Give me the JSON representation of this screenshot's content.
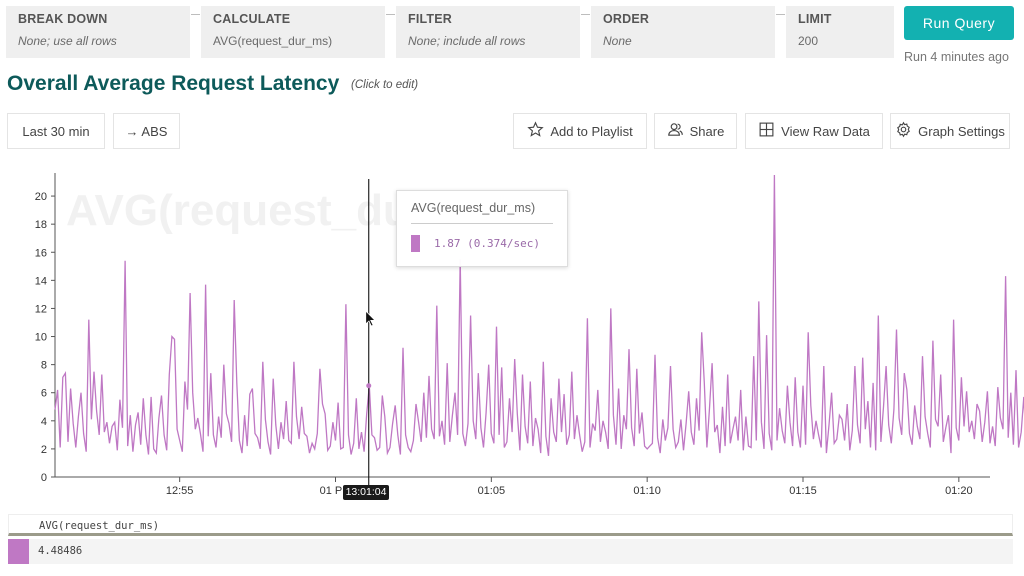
{
  "query": {
    "clauses": [
      {
        "label": "BREAK DOWN",
        "value": "None; use all rows",
        "italic": true
      },
      {
        "label": "CALCULATE",
        "value": "AVG(request_dur_ms)",
        "italic": false
      },
      {
        "label": "FILTER",
        "value": "None; include all rows",
        "italic": true
      },
      {
        "label": "ORDER",
        "value": "None",
        "italic": true
      },
      {
        "label": "LIMIT",
        "value": "200",
        "italic": false
      }
    ],
    "run_label": "Run Query",
    "run_status": "Run 4 minutes ago"
  },
  "header": {
    "title": "Overall Average Request Latency",
    "hint": "(Click to edit)"
  },
  "toolbar": {
    "time_range": "Last 30 min",
    "abs": "→ ABS",
    "add_playlist": "Add to Playlist",
    "share": "Share",
    "raw_data": "View Raw Data",
    "graph_settings": "Graph Settings"
  },
  "tooltip": {
    "title": "AVG(request_dur_ms)",
    "value": "1.87 (0.374/sec)"
  },
  "hover_time": "13:01:04",
  "legend": {
    "header": "AVG(request_dur_ms)",
    "value": "4.48486"
  },
  "colors": {
    "accent": "#13b1b1",
    "title": "#0d5a5a",
    "series": "#bf78c4"
  },
  "chart_data": {
    "type": "line",
    "watermark": "AVG(request_dur_ms)",
    "yticks": [
      0,
      2,
      4,
      6,
      8,
      10,
      12,
      14,
      16,
      18,
      20
    ],
    "ylim": [
      0,
      21.5
    ],
    "xlim": [
      "12:51",
      "13:21"
    ],
    "xticks": [
      "12:55",
      "01 PM",
      "01:05",
      "01:10",
      "01:15",
      "01:20"
    ],
    "hover_x": "13:01:04",
    "series": [
      {
        "name": "AVG(request_dur_ms)",
        "interval_seconds": 5,
        "start": "12:51:00",
        "values": [
          4.8,
          6.2,
          2.1,
          7.1,
          7.4,
          2.5,
          6.3,
          3.8,
          2.1,
          4.3,
          6.0,
          3.1,
          1.8,
          11.2,
          4.1,
          7.5,
          4.7,
          3.0,
          7.3,
          3.2,
          3.9,
          2.4,
          3.6,
          3.9,
          1.9,
          5.5,
          3.5,
          15.4,
          2.2,
          4.4,
          1.8,
          3.7,
          4.6,
          2.3,
          5.6,
          3.0,
          1.6,
          5.7,
          2.0,
          1.7,
          4.2,
          5.8,
          3.0,
          1.9,
          7.3,
          10.0,
          9.8,
          3.4,
          2.6,
          1.8,
          6.8,
          4.8,
          13.1,
          6.0,
          3.4,
          4.2,
          3.1,
          1.8,
          13.7,
          2.9,
          7.4,
          3.0,
          2.1,
          4.3,
          2.8,
          8.0,
          4.5,
          3.8,
          2.5,
          12.6,
          6.7,
          2.6,
          1.7,
          4.4,
          2.2,
          5.9,
          6.3,
          3.1,
          2.8,
          2.0,
          8.2,
          4.1,
          2.5,
          1.6,
          7.0,
          3.7,
          2.0,
          3.9,
          2.7,
          5.4,
          2.6,
          2.4,
          8.2,
          4.3,
          2.7,
          5.0,
          3.1,
          2.9,
          1.7,
          2.4,
          2.0,
          3.1,
          7.7,
          5.2,
          4.5,
          1.9,
          2.2,
          3.9,
          2.6,
          5.3,
          2.0,
          2.1,
          12.3,
          3.0,
          1.6,
          2.4,
          5.6,
          2.0,
          3.2,
          1.8,
          4.5,
          6.5,
          3.0,
          2.8,
          1.9,
          2.1,
          5.8,
          4.3,
          1.7,
          2.1,
          3.8,
          5.1,
          3.0,
          1.6,
          9.2,
          3.0,
          2.1,
          1.8,
          2.6,
          5.2,
          3.9,
          2.5,
          6.0,
          2.8,
          7.2,
          3.4,
          2.7,
          12.2,
          2.9,
          4.0,
          2.3,
          8.1,
          2.5,
          4.4,
          6.0,
          3.0,
          15.5,
          3.1,
          2.2,
          3.8,
          11.5,
          4.0,
          2.7,
          7.4,
          3.5,
          2.1,
          4.6,
          8.0,
          3.1,
          2.4,
          10.7,
          3.0,
          7.8,
          2.1,
          2.5,
          5.6,
          3.2,
          8.4,
          4.5,
          1.9,
          7.3,
          3.6,
          2.4,
          6.8,
          2.2,
          4.2,
          3.4,
          1.7,
          8.2,
          2.9,
          1.5,
          5.6,
          3.2,
          2.5,
          7.0,
          3.2,
          5.9,
          2.3,
          3.0,
          7.5,
          2.7,
          4.4,
          3.0,
          1.8,
          2.5,
          11.3,
          2.1,
          3.8,
          3.3,
          6.2,
          2.5,
          4.0,
          3.2,
          2.0,
          12.0,
          4.4,
          2.3,
          6.3,
          2.0,
          4.4,
          3.4,
          9.1,
          3.5,
          2.2,
          7.7,
          3.1,
          4.6,
          2.2,
          2.0,
          2.2,
          2.4,
          8.7,
          2.8,
          1.7,
          4.1,
          2.6,
          3.5,
          7.9,
          3.4,
          2.1,
          2.5,
          4.1,
          1.9,
          3.8,
          6.1,
          3.2,
          2.3,
          5.6,
          3.3,
          10.3,
          6.7,
          2.1,
          4.9,
          8.1,
          3.2,
          3.7,
          1.7,
          5.0,
          2.2,
          7.3,
          2.4,
          3.4,
          4.3,
          2.6,
          6.2,
          1.9,
          4.3,
          2.2,
          2.1,
          8.6,
          2.6,
          12.5,
          3.9,
          2.0,
          10.1,
          3.1,
          1.9,
          21.5,
          2.6,
          4.9,
          3.3,
          2.4,
          6.5,
          3.9,
          2.2,
          7.1,
          3.2,
          2.1,
          6.5,
          2.3,
          10.3,
          5.1,
          2.7,
          4.0,
          3.0,
          2.1,
          7.9,
          1.7,
          3.7,
          6.0,
          2.4,
          2.7,
          4.4,
          4.1,
          2.6,
          5.2,
          1.9,
          3.3,
          7.9,
          3.7,
          2.4,
          8.5,
          3.4,
          5.4,
          2.1,
          6.7,
          1.9,
          11.5,
          2.5,
          5.0,
          7.9,
          3.7,
          2.4,
          4.8,
          10.5,
          4.2,
          3.0,
          7.4,
          6.2,
          3.1,
          2.3,
          5.1,
          3.6,
          2.7,
          8.6,
          4.3,
          3.1,
          2.1,
          9.7,
          4.1,
          3.6,
          7.3,
          2.5,
          3.5,
          4.4,
          1.7,
          11.2,
          3.5,
          2.6,
          7.1,
          3.6,
          6.1,
          3.2,
          4.0,
          2.7,
          5.2,
          4.7,
          2.5,
          3.9,
          6.1,
          2.4,
          3.6,
          2.2,
          6.4,
          4.2,
          3.4,
          14.3,
          2.8,
          6.0,
          2.3,
          7.6,
          2.1,
          3.2,
          5.7,
          2.0,
          4.1,
          2.4,
          4.8,
          6.1,
          14.7,
          3.0,
          2.5,
          4.2,
          3.5,
          6.2,
          2.4,
          3.1,
          2.0,
          4.1,
          9.5,
          2.3,
          7.4,
          2.6,
          3.8,
          13.1,
          2.8,
          1.8,
          2.2
        ]
      }
    ]
  }
}
